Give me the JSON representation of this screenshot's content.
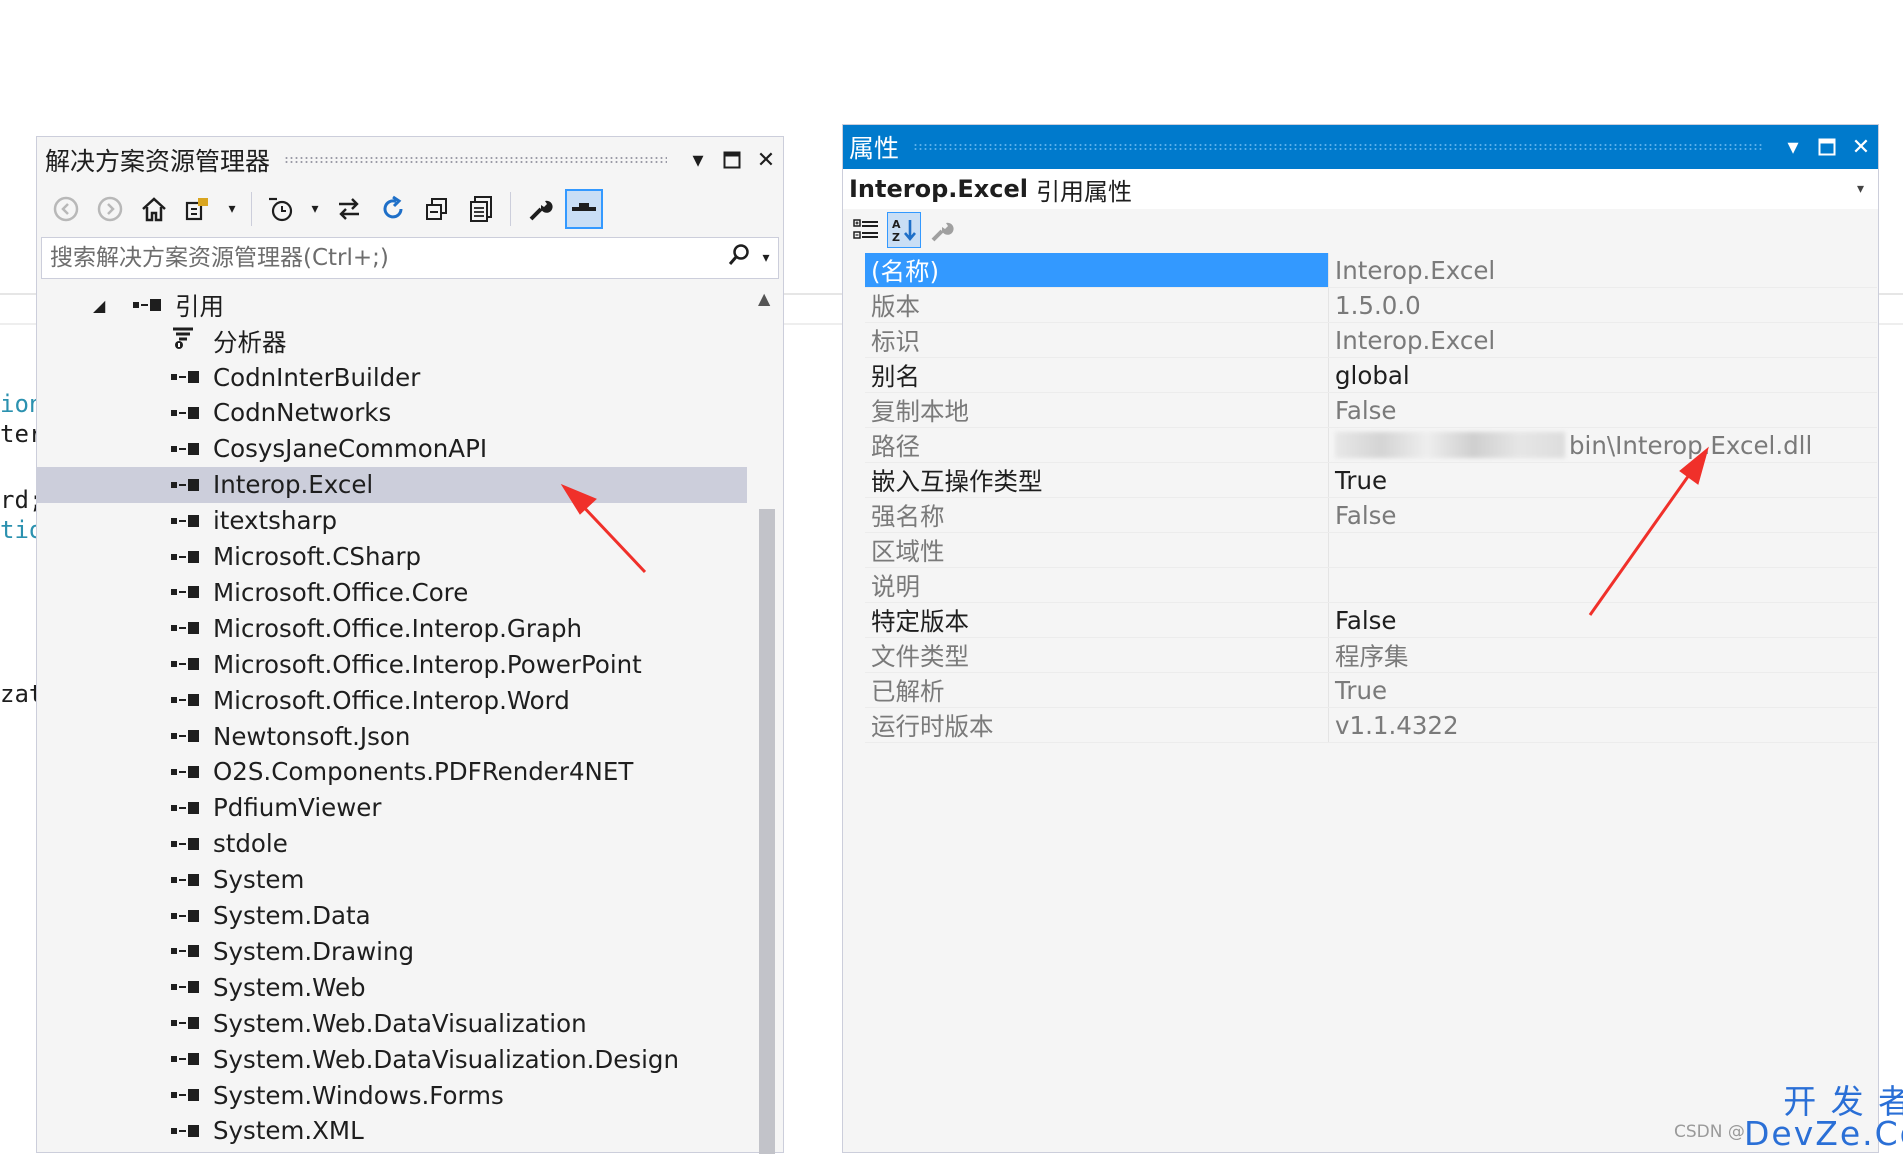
{
  "background_code": {
    "fragments": [
      {
        "text": "ion",
        "blue": true
      },
      {
        "text": "tero",
        "blue": false
      },
      {
        "text": "rd;",
        "blue": false
      },
      {
        "text": "tion",
        "blue": true
      },
      {
        "text": "zat",
        "blue": false
      }
    ]
  },
  "solution_explorer": {
    "title": "解决方案资源管理器",
    "search_placeholder": "搜索解决方案资源管理器(Ctrl+;)",
    "tree": {
      "references_label": "引用",
      "analyzer_label": "分析器",
      "selected_index": 3,
      "items": [
        "CodnInterBuilder",
        "CodnNetworks",
        "CosysJaneCommonAPI",
        "Interop.Excel",
        "itextsharp",
        "Microsoft.CSharp",
        "Microsoft.Office.Core",
        "Microsoft.Office.Interop.Graph",
        "Microsoft.Office.Interop.PowerPoint",
        "Microsoft.Office.Interop.Word",
        "Newtonsoft.Json",
        "O2S.Components.PDFRender4NET",
        "PdfiumViewer",
        "stdole",
        "System",
        "System.Data",
        "System.Drawing",
        "System.Web",
        "System.Web.DataVisualization",
        "System.Web.DataVisualization.Design",
        "System.Windows.Forms",
        "System.XML"
      ]
    }
  },
  "properties": {
    "title": "属性",
    "object_name": "Interop.Excel",
    "object_type": "引用属性",
    "rows": [
      {
        "name": "(名称)",
        "value": "Interop.Excel",
        "readonly": true,
        "selected": true
      },
      {
        "name": "版本",
        "value": "1.5.0.0",
        "readonly": true
      },
      {
        "name": "标识",
        "value": "Interop.Excel",
        "readonly": true
      },
      {
        "name": "别名",
        "value": "global",
        "readonly": false
      },
      {
        "name": "复制本地",
        "value": "False",
        "readonly": true
      },
      {
        "name": "路径",
        "value": "bin\\Interop.Excel.dll",
        "readonly": true,
        "blurred_prefix": true
      },
      {
        "name": "嵌入互操作类型",
        "value": "True",
        "readonly": false
      },
      {
        "name": "强名称",
        "value": "False",
        "readonly": true
      },
      {
        "name": "区域性",
        "value": "",
        "readonly": true
      },
      {
        "name": "说明",
        "value": "",
        "readonly": true
      },
      {
        "name": "特定版本",
        "value": "False",
        "readonly": false
      },
      {
        "name": "文件类型",
        "value": "程序集",
        "readonly": true
      },
      {
        "name": "已解析",
        "value": "True",
        "readonly": true
      },
      {
        "name": "运行时版本",
        "value": "v1.1.4322",
        "readonly": true
      }
    ]
  },
  "watermark": {
    "small": "CSDN @",
    "big_line1": "开 发 者",
    "big_line2": "DevZe.CoM"
  },
  "colors": {
    "accent": "#007acc",
    "selection": "#3399ff",
    "tree_selection": "#cccedb",
    "annotation": "#f0302a"
  }
}
